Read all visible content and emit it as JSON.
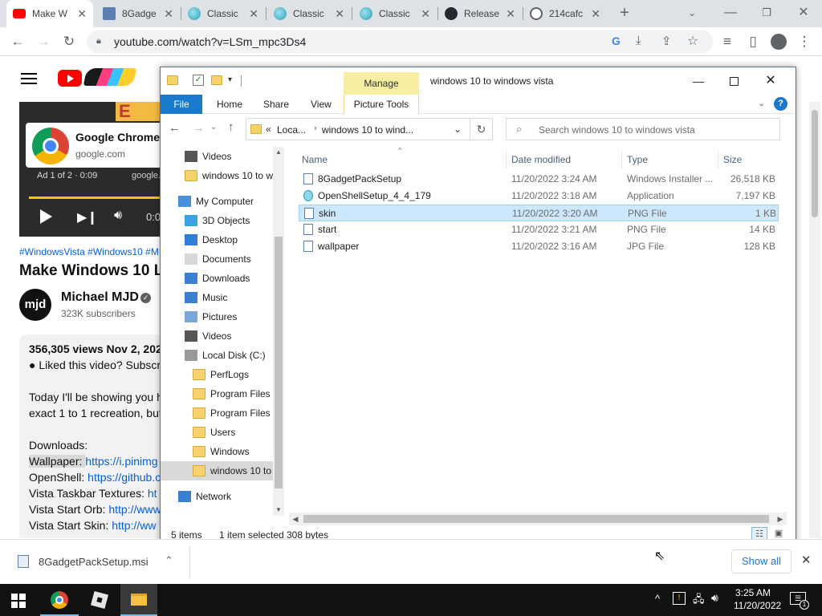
{
  "browser": {
    "tabs": [
      {
        "title": "Make W",
        "active": true
      },
      {
        "title": "8Gadge"
      },
      {
        "title": "Classic"
      },
      {
        "title": "Classic"
      },
      {
        "title": "Classic"
      },
      {
        "title": "Release"
      },
      {
        "title": "214cafc"
      }
    ],
    "new_tab_symbol": "+",
    "url": "youtube.com/watch?v=LSm_mpc3Ds4"
  },
  "youtube": {
    "ad_title": "Google Chrome",
    "ad_domain": "google.com",
    "ad_counter": "Ad 1 of 2 · 0:09",
    "ad_more": "google.c",
    "time_partial": "0:0",
    "banner_text": "E",
    "hashtags": "#WindowsVista #Windows10 #M",
    "video_title": "Make Windows 10 Lo",
    "channel_avatar": "mjd",
    "channel_name": "Michael MJD",
    "subscribers": "323K subscribers",
    "views_date": "356,305 views  Nov 2, 202",
    "desc_line1": "● Liked this video? Subscr",
    "desc_line2": "Today I'll be showing you h",
    "desc_line3": "exact 1 to 1 recreation, but",
    "downloads_label": "Downloads:",
    "links": [
      {
        "label": "Wallpaper: ",
        "url": "https://i.pinimg"
      },
      {
        "label": "OpenShell: ",
        "url": "https://github.c"
      },
      {
        "label": "Vista Taskbar Textures: ",
        "url": "ht"
      },
      {
        "label": "Vista Start Orb: ",
        "url": "http://www"
      },
      {
        "label": "Vista Start Skin: ",
        "url": "http://ww"
      }
    ]
  },
  "explorer": {
    "title": "windows 10 to windows vista",
    "manage_tab": "Manage",
    "ribbon_tabs": [
      "File",
      "Home",
      "Share",
      "View",
      "Picture Tools"
    ],
    "breadcrumb_prefix": "«",
    "breadcrumb_1": "Loca...",
    "breadcrumb_2": "windows 10 to wind...",
    "search_placeholder": "Search windows 10 to windows vista",
    "nav": [
      {
        "label": "Videos",
        "icon": "videos-icon",
        "indent": 1
      },
      {
        "label": "windows 10 to w",
        "icon": "folder-icon",
        "indent": 1
      },
      {
        "label": "My Computer",
        "icon": "computer-icon",
        "indent": 0
      },
      {
        "label": "3D Objects",
        "icon": "3d-objects-icon",
        "indent": 1
      },
      {
        "label": "Desktop",
        "icon": "desktop-icon",
        "indent": 1
      },
      {
        "label": "Documents",
        "icon": "documents-icon",
        "indent": 1
      },
      {
        "label": "Downloads",
        "icon": "downloads-icon",
        "indent": 1
      },
      {
        "label": "Music",
        "icon": "music-icon",
        "indent": 1
      },
      {
        "label": "Pictures",
        "icon": "pictures-icon",
        "indent": 1
      },
      {
        "label": "Videos",
        "icon": "videos-icon",
        "indent": 1
      },
      {
        "label": "Local Disk (C:)",
        "icon": "drive-icon",
        "indent": 1
      },
      {
        "label": "PerfLogs",
        "icon": "folder-icon",
        "indent": 2
      },
      {
        "label": "Program Files",
        "icon": "folder-icon",
        "indent": 2
      },
      {
        "label": "Program Files (",
        "icon": "folder-icon",
        "indent": 2
      },
      {
        "label": "Users",
        "icon": "folder-icon",
        "indent": 2
      },
      {
        "label": "Windows",
        "icon": "folder-icon",
        "indent": 2
      },
      {
        "label": "windows 10 to",
        "icon": "folder-icon",
        "indent": 2,
        "selected": true
      },
      {
        "label": "Network",
        "icon": "network-icon",
        "indent": 0
      }
    ],
    "columns": {
      "name": "Name",
      "date": "Date modified",
      "type": "Type",
      "size": "Size"
    },
    "files": [
      {
        "name": "8GadgetPackSetup",
        "date": "11/20/2022 3:24 AM",
        "type": "Windows Installer ...",
        "size": "26,518 KB",
        "icon": "installer-icon"
      },
      {
        "name": "OpenShellSetup_4_4_179",
        "date": "11/20/2022 3:18 AM",
        "type": "Application",
        "size": "7,197 KB",
        "icon": "application-icon"
      },
      {
        "name": "skin",
        "date": "11/20/2022 3:20 AM",
        "type": "PNG File",
        "size": "1 KB",
        "icon": "image-file-icon",
        "selected": true
      },
      {
        "name": "start",
        "date": "11/20/2022 3:21 AM",
        "type": "PNG File",
        "size": "14 KB",
        "icon": "image-file-icon"
      },
      {
        "name": "wallpaper",
        "date": "11/20/2022 3:16 AM",
        "type": "JPG File",
        "size": "128 KB",
        "icon": "image-file-icon"
      }
    ],
    "status": {
      "items": "5 items",
      "selected": "1 item selected",
      "size": "308 bytes"
    }
  },
  "download_bar": {
    "file": "8GadgetPackSetup.msi",
    "show_all": "Show all"
  },
  "taskbar": {
    "time": "3:25 AM",
    "date": "11/20/2022",
    "notification_count": "1"
  }
}
